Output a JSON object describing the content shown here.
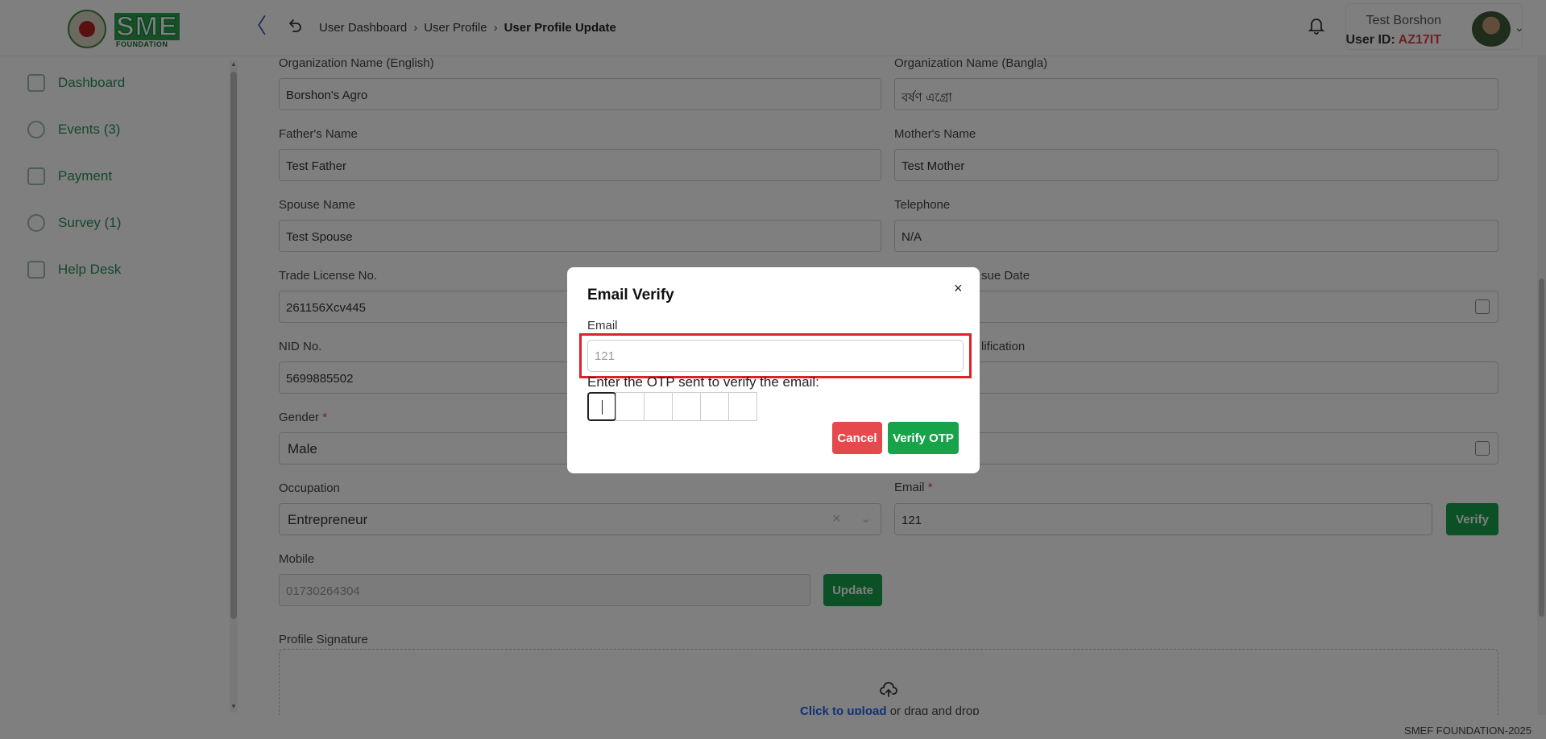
{
  "header": {
    "logo_text": "SME",
    "logo_sub": "FOUNDATION",
    "breadcrumb": [
      "User Dashboard",
      "User Profile",
      "User Profile Update"
    ],
    "user_name": "Test Borshon",
    "user_id_label": "User ID:",
    "user_id_value": "AZ17IT"
  },
  "sidebar": {
    "items": [
      {
        "label": "Dashboard",
        "icon": "grid-icon"
      },
      {
        "label": "Events (3)",
        "icon": "events-icon"
      },
      {
        "label": "Payment",
        "icon": "payment-icon"
      },
      {
        "label": "Survey (1)",
        "icon": "survey-icon"
      },
      {
        "label": "Help Desk",
        "icon": "mail-icon"
      }
    ]
  },
  "form": {
    "org_en_label": "Organization Name (English)",
    "org_en_value": "Borshon's Agro",
    "org_bn_label": "Organization Name (Bangla)",
    "org_bn_value": "বর্ষণ এগ্রো",
    "father_label": "Father's Name",
    "father_value": "Test Father",
    "mother_label": "Mother's Name",
    "mother_value": "Test Mother",
    "spouse_label": "Spouse Name",
    "spouse_value": "Test Spouse",
    "telephone_label": "Telephone",
    "telephone_value": "N/A",
    "trade_label": "Trade License No.",
    "trade_value": "261156Xcv445",
    "issue_date_label_fragment": "sue Date",
    "nid_label": "NID No.",
    "nid_value": "5699885502",
    "qualification_label_fragment": "lification",
    "gender_label": "Gender",
    "gender_value": "Male",
    "occupation_label": "Occupation",
    "occupation_value": "Entrepreneur",
    "email_label": "Email",
    "email_value": "121",
    "verify_label": "Verify",
    "mobile_label": "Mobile",
    "mobile_value": "01730264304",
    "update_label": "Update",
    "signature_label": "Profile Signature",
    "upload_link": "Click to upload",
    "upload_rest": "or drag and drop",
    "required_mark": "*",
    "clear_mark": "×"
  },
  "modal": {
    "title": "Email Verify",
    "close": "×",
    "email_label": "Email",
    "email_value": "121",
    "otp_label": "Enter the OTP sent to verify the email:",
    "otp_boxes": 6,
    "cancel_label": "Cancel",
    "verify_otp_label": "Verify OTP"
  },
  "footer": {
    "text": "SMEF FOUNDATION-2025"
  },
  "colors": {
    "brand_green": "#16a34a",
    "danger_red": "#e5484d",
    "highlight_red": "#e0202a"
  }
}
